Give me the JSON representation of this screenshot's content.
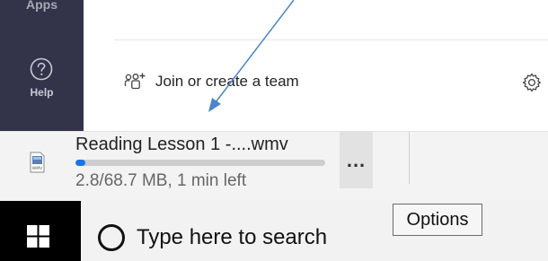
{
  "rail": {
    "apps_label": "Apps",
    "help_label": "Help"
  },
  "main": {
    "join_label": "Join or create a team"
  },
  "download": {
    "file_name": "Reading Lesson 1 -....wmv",
    "file_type_label": "WMV",
    "status": "2.8/68.7 MB, 1 min left",
    "progress_fraction": 0.041,
    "progress_color": "#1a73e8",
    "more_label": "...",
    "more_tooltip": "Options"
  },
  "taskbar": {
    "search_placeholder": "Type here to search"
  },
  "colors": {
    "rail_bg": "#33344a",
    "taskbar_start_bg": "#000000",
    "annotation_arrow": "#4a86c8"
  }
}
